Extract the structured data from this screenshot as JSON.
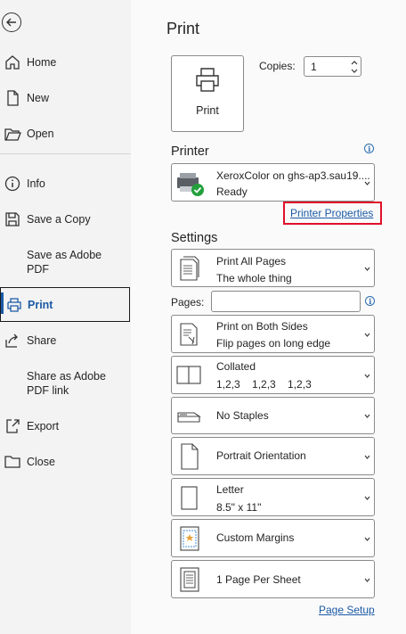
{
  "nav": {
    "items": [
      {
        "label": "Home",
        "icon": "home-icon"
      },
      {
        "label": "New",
        "icon": "new-document-icon"
      },
      {
        "label": "Open",
        "icon": "folder-open-icon"
      },
      {
        "label": "Info",
        "icon": "info-icon"
      },
      {
        "label": "Save a Copy",
        "icon": "save-icon"
      },
      {
        "label": "Save as Adobe PDF",
        "icon": ""
      },
      {
        "label": "Print",
        "icon": "printer-icon"
      },
      {
        "label": "Share",
        "icon": "share-icon"
      },
      {
        "label": "Share as Adobe PDF link",
        "icon": ""
      },
      {
        "label": "Export",
        "icon": "export-icon"
      },
      {
        "label": "Close",
        "icon": "folder-close-icon"
      }
    ],
    "save_adobe_l1": "Save as Adobe",
    "save_adobe_l2": "PDF",
    "share_adobe_l1": "Share as Adobe",
    "share_adobe_l2": "PDF link",
    "selected": "Print"
  },
  "main": {
    "title": "Print",
    "print_button": "Print",
    "copies_label": "Copies:",
    "copies_value": "1",
    "printer_section": "Printer",
    "printer": {
      "name": "XeroxColor on ghs-ap3.sau19....",
      "status": "Ready"
    },
    "printer_properties_link": "Printer Properties",
    "settings_section": "Settings",
    "settings": {
      "pages_scope": {
        "title": "Print All Pages",
        "subtitle": "The whole thing"
      },
      "pages_label": "Pages:",
      "pages_value": "",
      "sides": {
        "title": "Print on Both Sides",
        "subtitle": "Flip pages on long edge"
      },
      "collation": {
        "title": "Collated",
        "subtitle": "1,2,3    1,2,3    1,2,3"
      },
      "staples": {
        "title": "No Staples"
      },
      "orientation": {
        "title": "Portrait Orientation"
      },
      "paper": {
        "title": "Letter",
        "subtitle": "8.5\" x 11\""
      },
      "margins": {
        "title": "Custom Margins"
      },
      "per_sheet": {
        "title": "1 Page Per Sheet"
      }
    },
    "page_setup_link": "Page Setup"
  },
  "colors": {
    "accent": "#1b5aa6",
    "highlight": "#e0102a",
    "info": "#2b6cb0"
  }
}
